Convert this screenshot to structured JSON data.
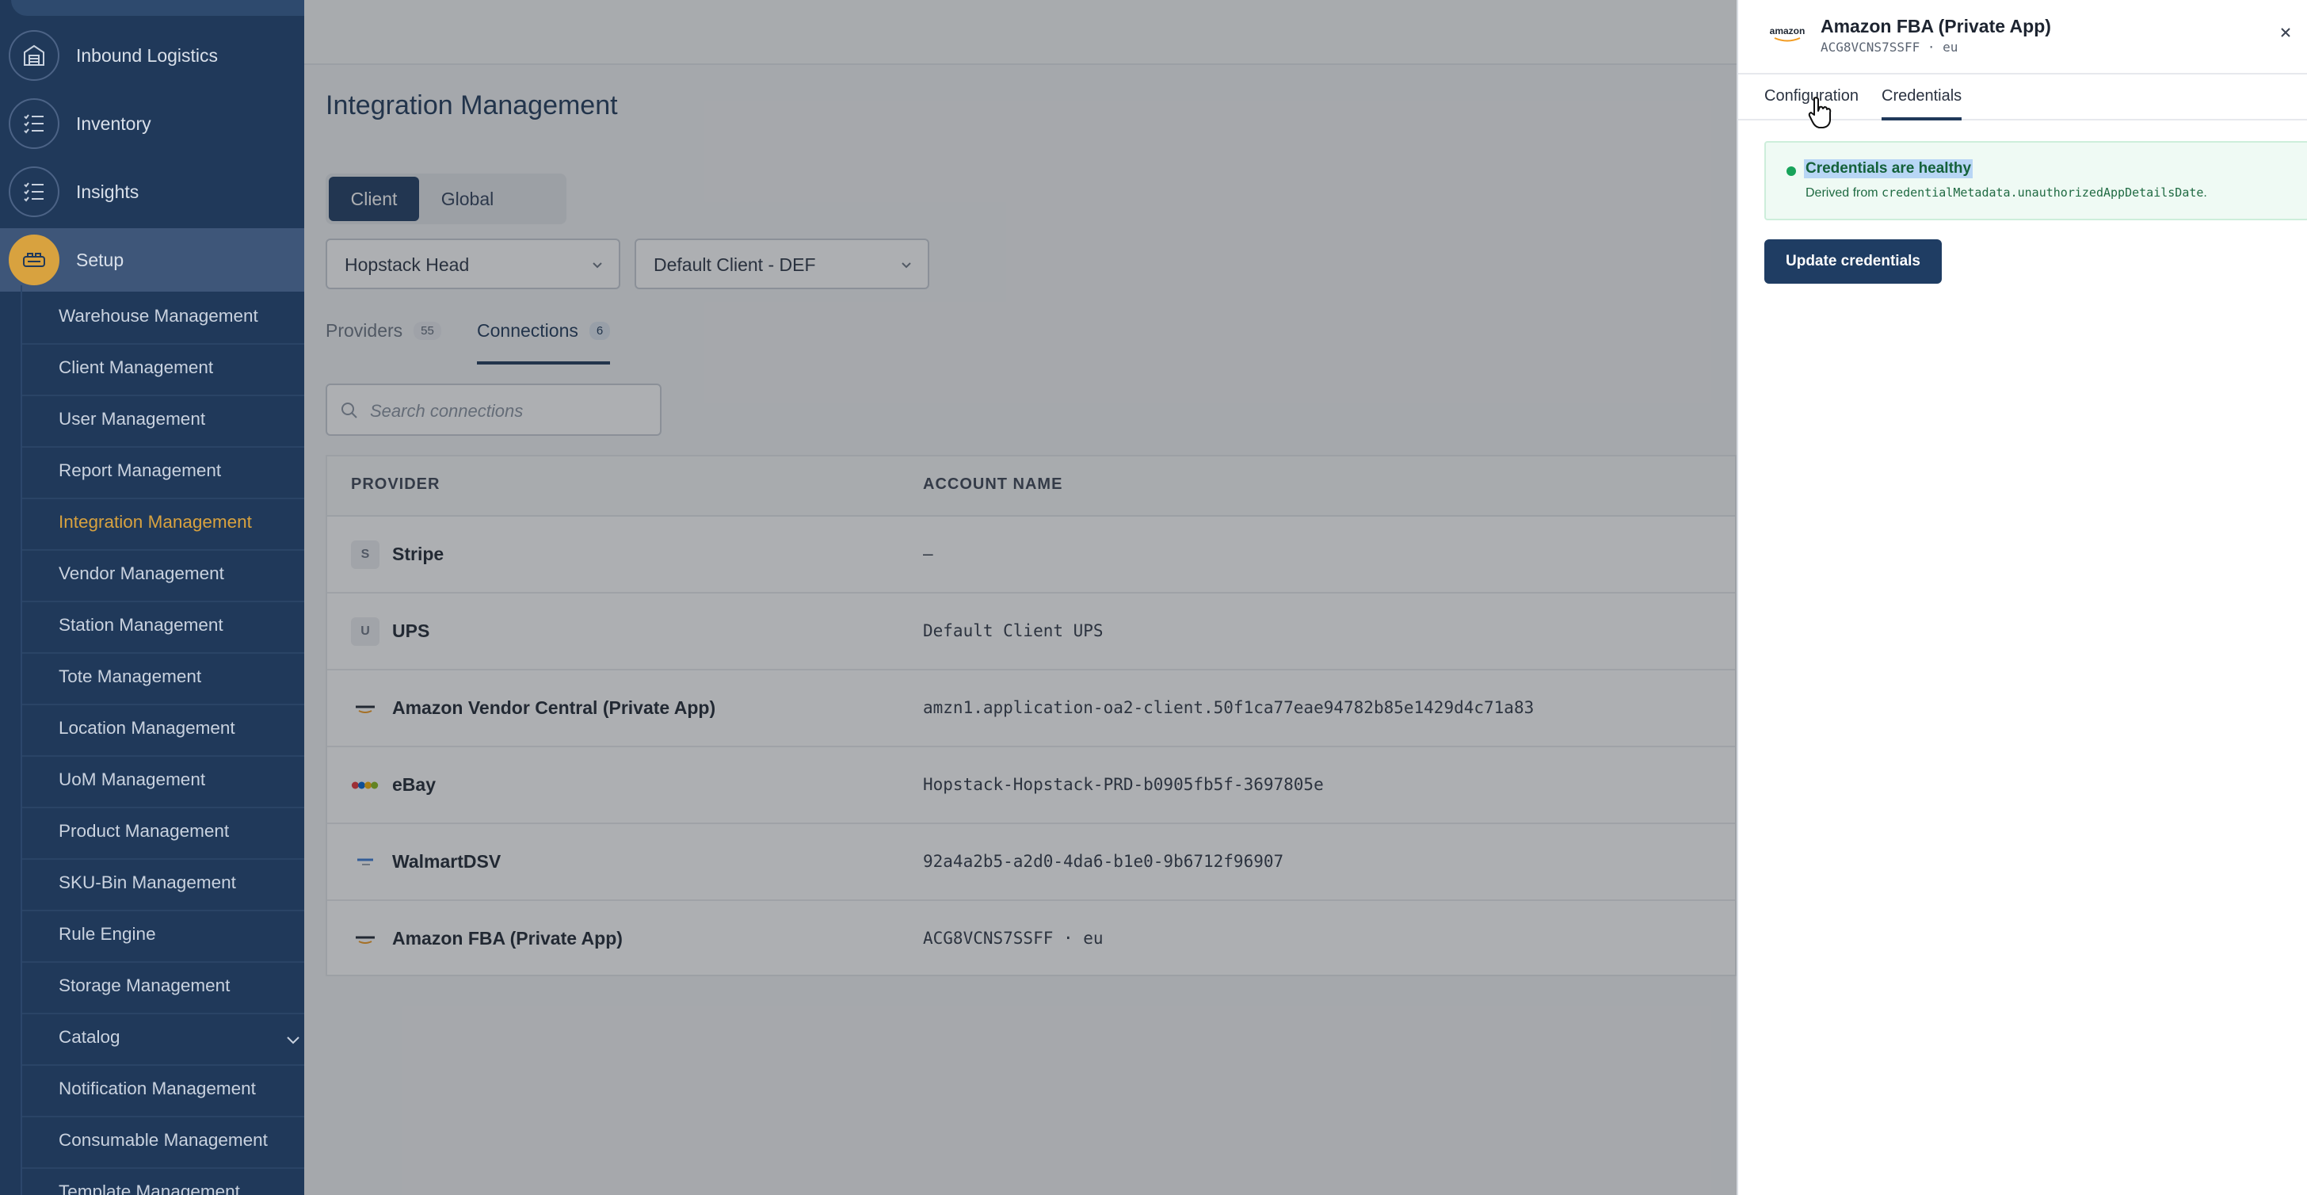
{
  "sidebar": {
    "main_items": [
      {
        "label": "Inbound Logistics",
        "icon": "warehouse-icon"
      },
      {
        "label": "Inventory",
        "icon": "checklist-icon"
      },
      {
        "label": "Insights",
        "icon": "checklist-icon"
      },
      {
        "label": "Setup",
        "icon": "setup-icon"
      }
    ],
    "sub_items": [
      "Warehouse Management",
      "Client Management",
      "User Management",
      "Report Management",
      "Integration Management",
      "Vendor Management",
      "Station Management",
      "Tote Management",
      "Location Management",
      "UoM Management",
      "Product Management",
      "SKU-Bin Management",
      "Rule Engine",
      "Storage Management",
      "Catalog",
      "Notification Management",
      "Consumable Management",
      "Template Management"
    ]
  },
  "main": {
    "title": "Integration Management",
    "scope_toggle": {
      "client": "Client",
      "global": "Global"
    },
    "warehouse_select": "Hopstack Head",
    "client_select": "Default Client - DEF",
    "tabs": [
      {
        "label": "Providers",
        "count": "55"
      },
      {
        "label": "Connections",
        "count": "6"
      }
    ],
    "search_placeholder": "Search connections",
    "table": {
      "headers": [
        "PROVIDER",
        "ACCOUNT NAME"
      ],
      "rows": [
        {
          "icon": "S",
          "provider": "Stripe",
          "account": "–"
        },
        {
          "icon": "U",
          "provider": "UPS",
          "account": "Default Client UPS"
        },
        {
          "icon": "amazon",
          "provider": "Amazon Vendor Central (Private App)",
          "account": "amzn1.application-oa2-client.50f1ca77eae94782b85e1429d4c71a83"
        },
        {
          "icon": "ebay",
          "provider": "eBay",
          "account": "Hopstack-Hopstack-PRD-b0905fb5f-3697805e"
        },
        {
          "icon": "walmart",
          "provider": "WalmartDSV",
          "account": "92a4a2b5-a2d0-4da6-b1e0-9b6712f96907"
        },
        {
          "icon": "amazon",
          "provider": "Amazon FBA (Private App)",
          "account": "ACG8VCNS7SSFF · eu"
        }
      ]
    }
  },
  "drawer": {
    "logo_text": "amazon",
    "title": "Amazon FBA (Private App)",
    "subtitle": "ACG8VCNS7SSFF · eu",
    "tabs": [
      "Configuration",
      "Credentials"
    ],
    "alert": {
      "title": "Credentials are healthy",
      "desc_prefix": "Derived from ",
      "desc_code": "credentialMetadata.unauthorizedAppDetailsDate",
      "desc_suffix": "."
    },
    "update_button": "Update credentials"
  },
  "colors": {
    "sidebar_bg": "#20395a",
    "accent_gold": "#d8a23f",
    "primary_button": "#1f3d63",
    "success": "#17a35a"
  }
}
